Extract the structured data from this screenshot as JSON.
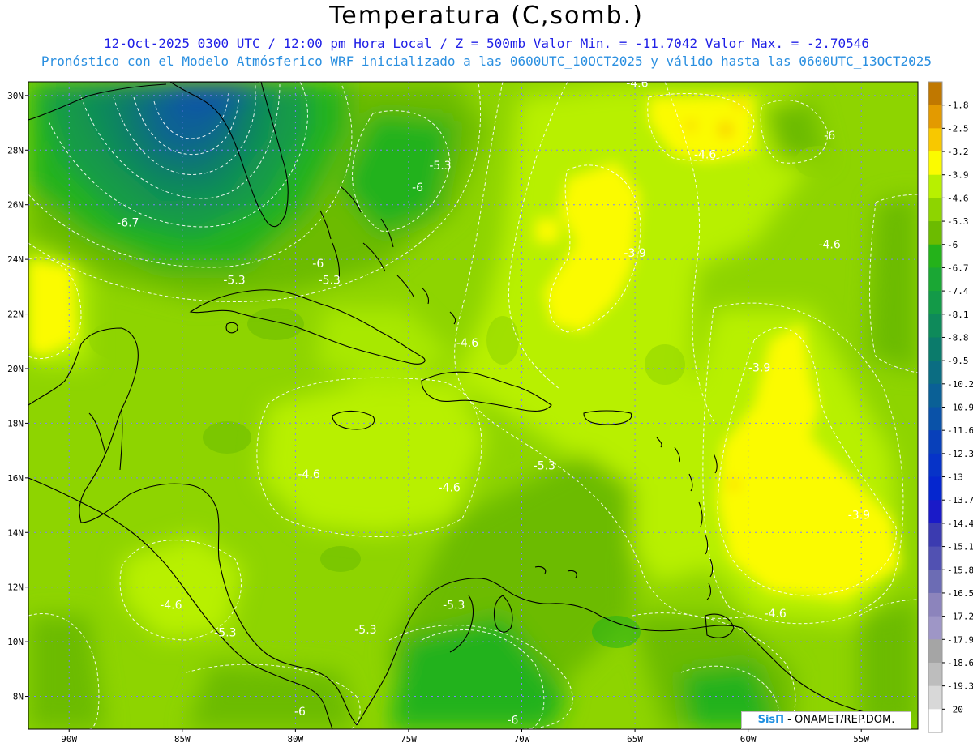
{
  "title": "Temperatura (C,somb.)",
  "subtitle_line1": "12-Oct-2025  0300 UTC / 12:00 pm Hora Local / Z = 500mb  Valor Min. = -11.7042  Valor Max. = -2.70546",
  "subtitle_line2": "Pronóstico con el Modelo Atmósferico WRF inicializado a las 0600UTC_10OCT2025 y válido hasta las  0600UTC_13OCT2025",
  "credit": {
    "logo": "SisΠ",
    "text": " - ONAMET/REP.DOM."
  },
  "axes": {
    "lat_labels": [
      "30N",
      "28N",
      "26N",
      "24N",
      "22N",
      "20N",
      "18N",
      "16N",
      "14N",
      "12N",
      "10N",
      "8N"
    ],
    "lat_values": [
      30,
      28,
      26,
      24,
      22,
      20,
      18,
      16,
      14,
      12,
      10,
      8
    ],
    "lon_labels": [
      "90W",
      "85W",
      "80W",
      "75W",
      "70W",
      "65W",
      "60W",
      "55W"
    ],
    "lon_values": [
      -90,
      -85,
      -80,
      -75,
      -70,
      -65,
      -60,
      -55
    ],
    "lat_range": [
      6.8,
      30.5
    ],
    "lon_range": [
      -91.8,
      -52.5
    ]
  },
  "colorbar": {
    "labels": [
      "-1.8",
      "-2.5",
      "-3.2",
      "-3.9",
      "-4.6",
      "-5.3",
      "-6",
      "-6.7",
      "-7.4",
      "-8.1",
      "-8.8",
      "-9.5",
      "-10.2",
      "-10.9",
      "-11.6",
      "-12.3",
      "-13",
      "-13.7",
      "-14.4",
      "-15.1",
      "-15.8",
      "-16.5",
      "-17.2",
      "-17.9",
      "-18.6",
      "-19.3",
      "-20"
    ],
    "colors": [
      "#c07800",
      "#e39a00",
      "#f8c800",
      "#fbfb00",
      "#b8f000",
      "#8ed400",
      "#6cbb00",
      "#24b21a",
      "#1aa734",
      "#139a48",
      "#0e8a5a",
      "#0b7b6b",
      "#0b6d82",
      "#0a6096",
      "#0a52a8",
      "#0840ba",
      "#0633c8",
      "#0526cf",
      "#1a1ac8",
      "#3b3bb0",
      "#5151b2",
      "#6c6cb4",
      "#8c84bc",
      "#9e96c6",
      "#a5a5a5",
      "#bdbdbd",
      "#d8d8d8",
      "#ffffff"
    ]
  },
  "contour_labels": [
    {
      "text": "-4.6",
      "lon": -64.9,
      "lat": 30.3
    },
    {
      "text": "-6",
      "lon": -56.4,
      "lat": 28.4
    },
    {
      "text": "-4.6",
      "lon": -61.9,
      "lat": 27.7
    },
    {
      "text": "-5.3",
      "lon": -73.6,
      "lat": 27.3
    },
    {
      "text": "-6",
      "lon": -74.6,
      "lat": 26.5
    },
    {
      "text": "-6.7",
      "lon": -87.4,
      "lat": 25.2
    },
    {
      "text": "-4.6",
      "lon": -56.4,
      "lat": 24.4
    },
    {
      "text": "-3.9",
      "lon": -65.0,
      "lat": 24.1
    },
    {
      "text": "-6",
      "lon": -79.0,
      "lat": 23.7
    },
    {
      "text": "-5.3",
      "lon": -82.7,
      "lat": 23.1
    },
    {
      "text": "-5.3",
      "lon": -78.5,
      "lat": 23.1
    },
    {
      "text": "-4.6",
      "lon": -72.4,
      "lat": 20.8
    },
    {
      "text": "-3.9",
      "lon": -59.5,
      "lat": 19.9
    },
    {
      "text": "-4.6",
      "lon": -79.4,
      "lat": 16.0
    },
    {
      "text": "-5.3",
      "lon": -69.0,
      "lat": 16.3
    },
    {
      "text": "-4.6",
      "lon": -73.2,
      "lat": 15.5
    },
    {
      "text": "-3.9",
      "lon": -55.1,
      "lat": 14.5
    },
    {
      "text": "-4.6",
      "lon": -85.5,
      "lat": 11.2
    },
    {
      "text": "-5.3",
      "lon": -73.0,
      "lat": 11.2
    },
    {
      "text": "-4.6",
      "lon": -58.8,
      "lat": 10.9
    },
    {
      "text": "-5.3",
      "lon": -83.1,
      "lat": 10.2
    },
    {
      "text": "-5.3",
      "lon": -76.9,
      "lat": 10.3
    },
    {
      "text": "-6",
      "lon": -79.8,
      "lat": 7.3
    },
    {
      "text": "-6",
      "lon": -70.4,
      "lat": 7.0
    }
  ]
}
